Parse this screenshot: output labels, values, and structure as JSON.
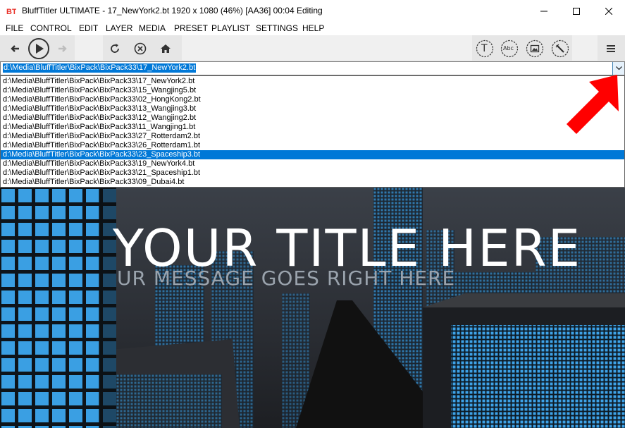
{
  "window": {
    "title": "BluffTitler ULTIMATE  -  17_NewYork2.bt 1920 x 1080 (46%) [AA36] 00:04 Editing"
  },
  "menu": [
    "FILE",
    "CONTROL",
    "EDIT",
    "LAYER",
    "MEDIA",
    "PRESET",
    "PLAYLIST",
    "SETTINGS",
    "HELP"
  ],
  "toolbar": {
    "left_icons": [
      "back-arrow-icon",
      "play-icon",
      "forward-arrow-icon"
    ],
    "mid_icons": [
      "refresh-icon",
      "stop-icon",
      "home-icon"
    ],
    "right_icons": [
      "text-layer-icon",
      "abc-layer-icon",
      "picture-layer-icon",
      "effect-layer-icon"
    ],
    "right_labels": [
      "T",
      "Abc"
    ],
    "menu_icon": "hamburger-menu-icon"
  },
  "combo": {
    "value": "d:\\Media\\BluffTitler\\BixPack\\BixPack33\\17_NewYork2.bt"
  },
  "dropdown": {
    "items": [
      "d:\\Media\\BluffTitler\\BixPack\\BixPack33\\17_NewYork2.bt",
      "d:\\Media\\BluffTitler\\BixPack\\BixPack33\\15_Wangjing5.bt",
      "d:\\Media\\BluffTitler\\BixPack\\BixPack33\\02_HongKong2.bt",
      "d:\\Media\\BluffTitler\\BixPack\\BixPack33\\13_Wangjing3.bt",
      "d:\\Media\\BluffTitler\\BixPack\\BixPack33\\12_Wangjing2.bt",
      "d:\\Media\\BluffTitler\\BixPack\\BixPack33\\11_Wangjing1.bt",
      "d:\\Media\\BluffTitler\\BixPack\\BixPack33\\27_Rotterdam2.bt",
      "d:\\Media\\BluffTitler\\BixPack\\BixPack33\\26_Rotterdam1.bt",
      "d:\\Media\\BluffTitler\\BixPack\\BixPack33\\23_Spaceship3.bt",
      "d:\\Media\\BluffTitler\\BixPack\\BixPack33\\19_NewYork4.bt",
      "d:\\Media\\BluffTitler\\BixPack\\BixPack33\\21_Spaceship1.bt",
      "d:\\Media\\BluffTitler\\BixPack\\BixPack33\\09_Dubai4.bt"
    ],
    "selected_index": 8
  },
  "preview": {
    "title": "YOUR TITLE HERE",
    "subtitle": "UR MESSAGE GOES RIGHT HERE"
  },
  "colors": {
    "selection": "#0078d7",
    "annotation_arrow": "#ff0000",
    "window_blue": "#3ea3e8"
  }
}
